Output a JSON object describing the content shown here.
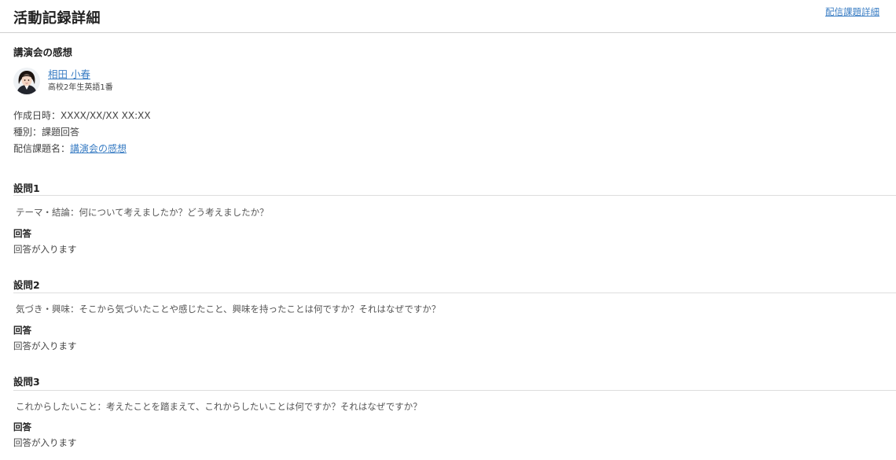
{
  "header": {
    "title": "活動記録詳細",
    "link_label": "配信課題詳細"
  },
  "record": {
    "title": "講演会の感想",
    "author": {
      "name": "相田 小春",
      "class_info": "高校2年生英語1番",
      "avatar_icon": "student-avatar-icon"
    },
    "created_label": "作成日時：",
    "created_value": "XXXX/XX/XX XX:XX",
    "type_label": "種別：",
    "type_value": "課題回答",
    "assignment_label": "配信課題名：",
    "assignment_value": "講演会の感想"
  },
  "questions": [
    {
      "heading": "設問1",
      "text": "テーマ・結論：何について考えましたか？どう考えましたか？",
      "answer_label": "回答",
      "answer": "回答が入ります"
    },
    {
      "heading": "設問2",
      "text": "気づき・興味：そこから気づいたことや感じたこと、興味を持ったことは何ですか？それはなぜですか？",
      "answer_label": "回答",
      "answer": "回答が入ります"
    },
    {
      "heading": "設問3",
      "text": "これからしたいこと：考えたことを踏まえて、これからしたいことは何ですか？それはなぜですか？",
      "answer_label": "回答",
      "answer": "回答が入ります"
    }
  ],
  "colors": {
    "link": "#3b7ec4",
    "divider": "#dedede",
    "header_rule": "#cfcfcf"
  }
}
